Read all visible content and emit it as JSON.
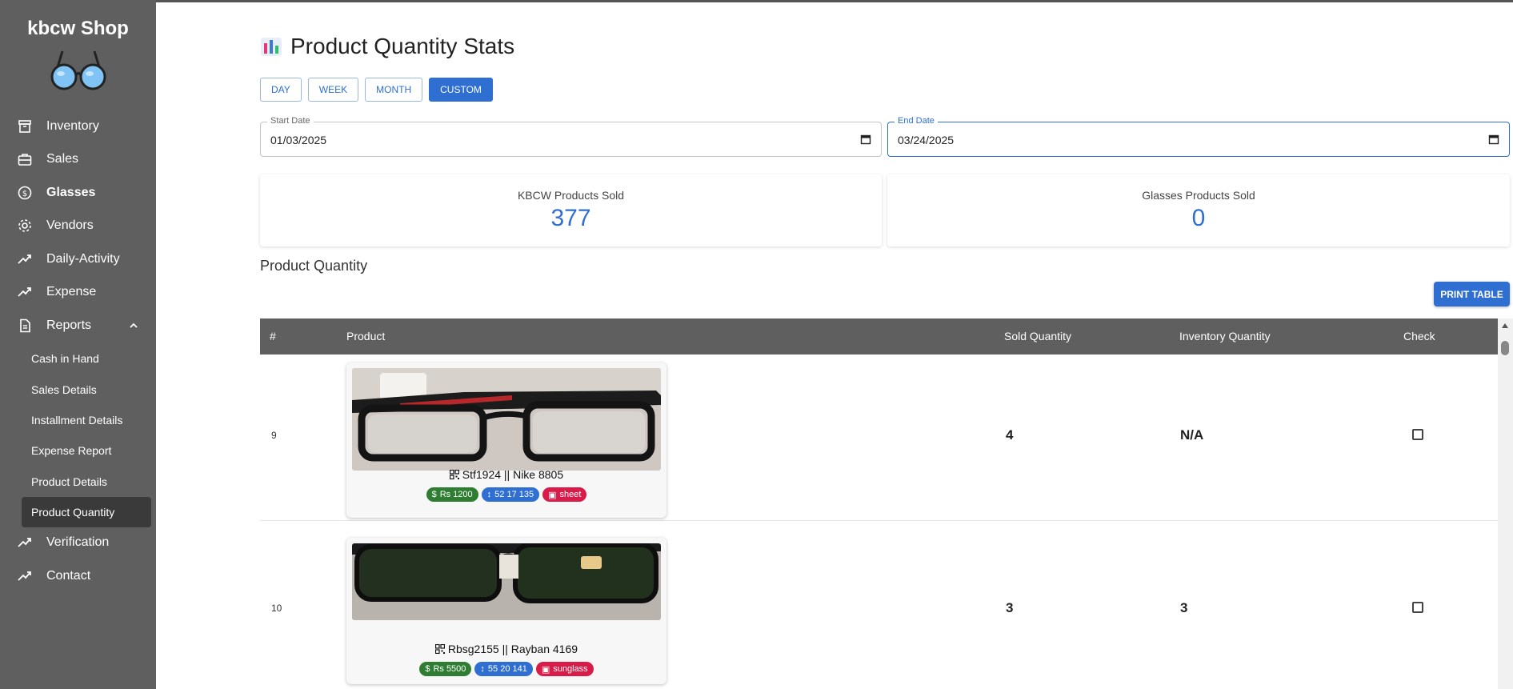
{
  "sidebar": {
    "brand": "kbcw Shop",
    "items": [
      {
        "label": "Inventory",
        "icon": "archive-icon"
      },
      {
        "label": "Sales",
        "icon": "briefcase-icon"
      },
      {
        "label": "Glasses",
        "icon": "dollar-circle-icon"
      },
      {
        "label": "Vendors",
        "icon": "gear-icon"
      },
      {
        "label": "Daily-Activity",
        "icon": "trending-up-icon"
      },
      {
        "label": "Expense",
        "icon": "trending-up-icon"
      },
      {
        "label": "Reports",
        "icon": "document-icon"
      }
    ],
    "report_items": [
      {
        "label": "Cash in Hand"
      },
      {
        "label": "Sales Details"
      },
      {
        "label": "Installment Details"
      },
      {
        "label": "Expense Report"
      },
      {
        "label": "Product Details"
      },
      {
        "label": "Product Quantity"
      }
    ],
    "bottom_items": [
      {
        "label": "Verification",
        "icon": "trending-up-icon"
      },
      {
        "label": "Contact",
        "icon": "trending-up-icon"
      }
    ]
  },
  "page": {
    "title": "Product Quantity Stats",
    "range_buttons": [
      "DAY",
      "WEEK",
      "MONTH",
      "CUSTOM"
    ],
    "active_range": "CUSTOM",
    "start_date": {
      "label": "Start Date",
      "value": "01/03/2025"
    },
    "end_date": {
      "label": "End Date",
      "value": "03/24/2025"
    },
    "stats": [
      {
        "label": "KBCW Products Sold",
        "value": "377"
      },
      {
        "label": "Glasses Products Sold",
        "value": "0"
      }
    ],
    "section_title": "Product Quantity",
    "print_label": "PRINT TABLE"
  },
  "table": {
    "headers": [
      "#",
      "Product",
      "Sold Quantity",
      "Inventory Quantity",
      "Check"
    ],
    "rows": [
      {
        "index": "9",
        "name": "Stf1924 || Nike 8805",
        "price": "Rs 1200",
        "size": "52 17 135",
        "type": "sheet",
        "sold": "4",
        "inventory": "N/A"
      },
      {
        "index": "10",
        "name": "Rbsg2155 || Rayban 4169",
        "price": "Rs 5500",
        "size": "55 20 141",
        "type": "sunglass",
        "sold": "3",
        "inventory": "3"
      }
    ]
  },
  "colors": {
    "sidebar": "#5f5f5f",
    "accent": "#2f6fd1",
    "chip_price": "#2e7d32",
    "chip_size": "#2f6fd1",
    "chip_type": "#d81b48"
  }
}
